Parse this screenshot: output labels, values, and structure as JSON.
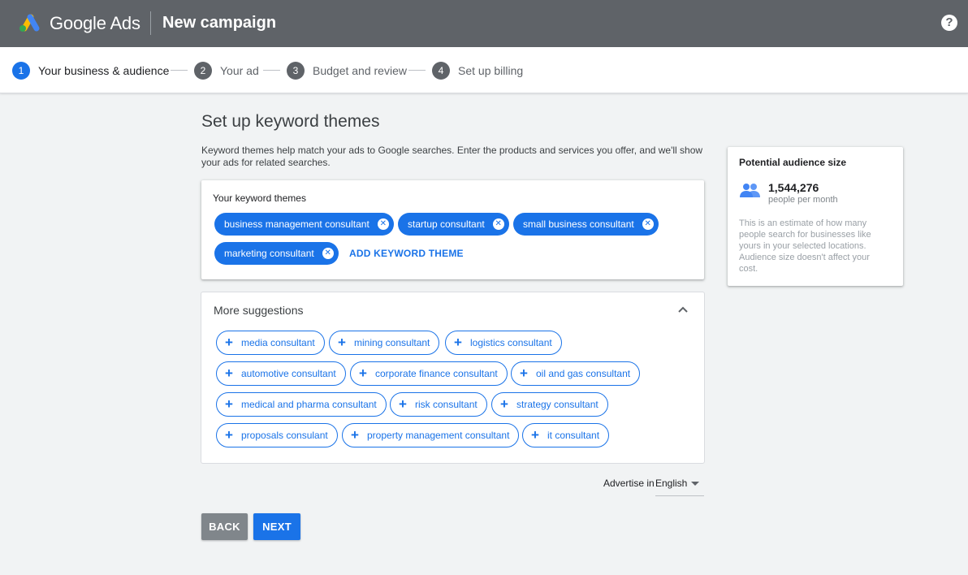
{
  "header": {
    "brand": "Google Ads",
    "title": "New campaign",
    "help_icon": "help-circle-icon",
    "help_glyph": "?"
  },
  "stepper": {
    "steps": [
      {
        "number": "1",
        "label": "Your business & audience",
        "active": true
      },
      {
        "number": "2",
        "label": "Your ad",
        "active": false
      },
      {
        "number": "3",
        "label": "Budget and review",
        "active": false
      },
      {
        "number": "4",
        "label": "Set up billing",
        "active": false
      }
    ]
  },
  "main": {
    "title": "Set up keyword themes",
    "description": "Keyword themes help match your ads to Google searches. Enter the products and services you offer, and we'll show your ads for related searches.",
    "keyword_themes": {
      "title": "Your keyword themes",
      "chips": [
        "business management consultant",
        "startup consultant",
        "small business consultant",
        "marketing consultant"
      ],
      "remove_glyph": "✕",
      "add_label": "ADD KEYWORD THEME"
    },
    "suggestions": {
      "title": "More suggestions",
      "plus_glyph": "+",
      "chips": [
        "media consultant",
        "mining consultant",
        "logistics consultant",
        "automotive consultant",
        "corporate finance consultant",
        "oil and gas consultant",
        "medical and pharma consultant",
        "risk consultant",
        "strategy consultant",
        "proposals consulant",
        "property management consultant",
        "it consultant"
      ]
    },
    "advertise_in": {
      "label": "Advertise in",
      "value": "English"
    },
    "buttons": {
      "back": "BACK",
      "next": "NEXT"
    }
  },
  "audience": {
    "title": "Potential audience size",
    "count": "1,544,276",
    "unit": "people per month",
    "note": "This is an estimate of how many people search for businesses like yours in your selected locations. Audience size doesn't affect your cost."
  },
  "colors": {
    "header_bg": "#5f6368",
    "accent": "#1a73e8",
    "page_bg": "#f1f3f4",
    "back_button": "#80868b"
  }
}
